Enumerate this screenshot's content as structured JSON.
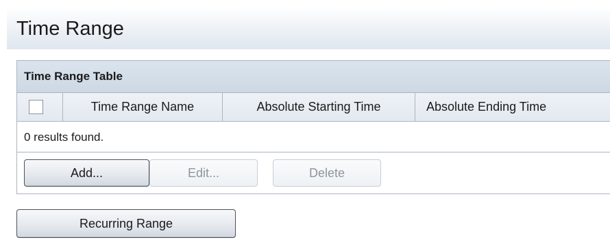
{
  "page": {
    "title": "Time Range"
  },
  "table": {
    "title": "Time Range Table",
    "columns": [
      "Time Range Name",
      "Absolute Starting Time",
      "Absolute Ending Time"
    ],
    "results_text": "0 results found."
  },
  "buttons": {
    "add_label": "Add...",
    "edit_label": "Edit...",
    "delete_label": "Delete",
    "recurring_label": "Recurring Range"
  }
}
